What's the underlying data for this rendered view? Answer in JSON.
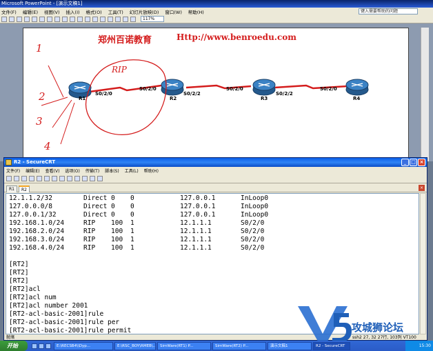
{
  "ppt": {
    "title": "Microsoft PowerPoint - [演示文稿1]",
    "menu": [
      "文件(F)",
      "编辑(E)",
      "视图(V)",
      "插入(I)",
      "格式(O)",
      "工具(T)",
      "幻灯片放映(D)",
      "窗口(W)",
      "帮助(H)"
    ],
    "help_placeholder": "键入需要帮助的问题",
    "zoom": "117%",
    "slide": {
      "title": "郑州百诺教育",
      "url": "Http://www.benroedu.com",
      "routers": [
        "R1",
        "R2",
        "R3",
        "R4"
      ],
      "links": [
        "S0/2/0",
        "S0/2/0",
        "S0/2/2",
        "S0/2/0",
        "S0/2/2",
        "S0/2/0"
      ],
      "annotations": {
        "rip": "RIP",
        "n1": "1",
        "n2": "2",
        "n3": "3",
        "n4": "4"
      }
    }
  },
  "crt": {
    "title": "R2 - SecureCRT",
    "menu": [
      "文件(F)",
      "编辑(E)",
      "查看(V)",
      "选项(O)",
      "传输(T)",
      "脚本(S)",
      "工具(L)",
      "帮助(H)"
    ],
    "tabs": [
      "R1",
      "R2"
    ],
    "routes": [
      {
        "dest": "12.1.1.2/32",
        "proto": "Direct",
        "pre": "0",
        "cost": "0",
        "nexthop": "127.0.0.1",
        "iface": "InLoop0"
      },
      {
        "dest": "127.0.0.0/8",
        "proto": "Direct",
        "pre": "0",
        "cost": "0",
        "nexthop": "127.0.0.1",
        "iface": "InLoop0"
      },
      {
        "dest": "127.0.0.1/32",
        "proto": "Direct",
        "pre": "0",
        "cost": "0",
        "nexthop": "127.0.0.1",
        "iface": "InLoop0"
      },
      {
        "dest": "192.168.1.0/24",
        "proto": "RIP",
        "pre": "100",
        "cost": "1",
        "nexthop": "12.1.1.1",
        "iface": "S0/2/0"
      },
      {
        "dest": "192.168.2.0/24",
        "proto": "RIP",
        "pre": "100",
        "cost": "1",
        "nexthop": "12.1.1.1",
        "iface": "S0/2/0"
      },
      {
        "dest": "192.168.3.0/24",
        "proto": "RIP",
        "pre": "100",
        "cost": "1",
        "nexthop": "12.1.1.1",
        "iface": "S0/2/0"
      },
      {
        "dest": "192.168.4.0/24",
        "proto": "RIP",
        "pre": "100",
        "cost": "1",
        "nexthop": "12.1.1.1",
        "iface": "S0/2/0"
      }
    ],
    "lines": [
      "[RT2]",
      "[RT2]",
      "[RT2]",
      "[RT2]acl",
      "[RT2]acl num",
      "[RT2]acl number 2001",
      "[RT2-acl-basic-2001]rule",
      "[RT2-acl-basic-2001]rule per",
      "[RT2-acl-basic-2001]rule permit"
    ],
    "status_left": "就绪",
    "status_right": "ssh2 27, 32  27行, 103列  VT100"
  },
  "watermark": "攻城狮论坛",
  "taskbar": {
    "start": "开始",
    "tasks": [
      "E:\\RECSB4\\\\Dyp...",
      "E:\\RSC_BOY\\RMEB\\...",
      "SimWare(RT1) P...",
      "SimWare(RT2) P...",
      "演示文稿1",
      "R2 - SecureCRT"
    ],
    "clock": "15:30"
  },
  "colors": {
    "accent_red": "#d41c1c",
    "title_blue": "#0a5ee8",
    "handwriting": "#d41c1c",
    "link": "#d41c1c",
    "router": "#2f6fae"
  }
}
